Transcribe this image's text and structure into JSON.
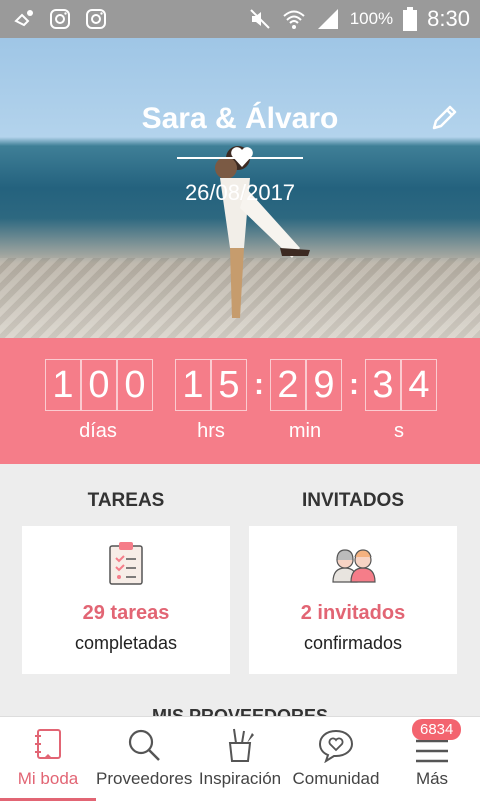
{
  "status": {
    "battery": "100%",
    "time": "8:30"
  },
  "hero": {
    "title": "Sara & Álvaro",
    "date": "26/08/2017"
  },
  "countdown": {
    "days": [
      "1",
      "0",
      "0"
    ],
    "hours": [
      "1",
      "5"
    ],
    "minutes": [
      "2",
      "9"
    ],
    "seconds": [
      "3",
      "4"
    ],
    "labels": {
      "days": "días",
      "hours": "hrs",
      "minutes": "min",
      "seconds": "s"
    }
  },
  "tasks": {
    "heading": "TAREAS",
    "count": "29 tareas",
    "status": "completadas"
  },
  "guests": {
    "heading": "INVITADOS",
    "count": "2 invitados",
    "status": "confirmados"
  },
  "section_peek": "MIS PROVEEDORES",
  "nav": {
    "items": [
      "Mi boda",
      "Proveedores",
      "Inspiración",
      "Comunidad",
      "Más"
    ],
    "badge": "6834"
  },
  "colors": {
    "accent": "#f57d89",
    "accent_text": "#e26574",
    "status_bar": "#9a9a9a"
  }
}
